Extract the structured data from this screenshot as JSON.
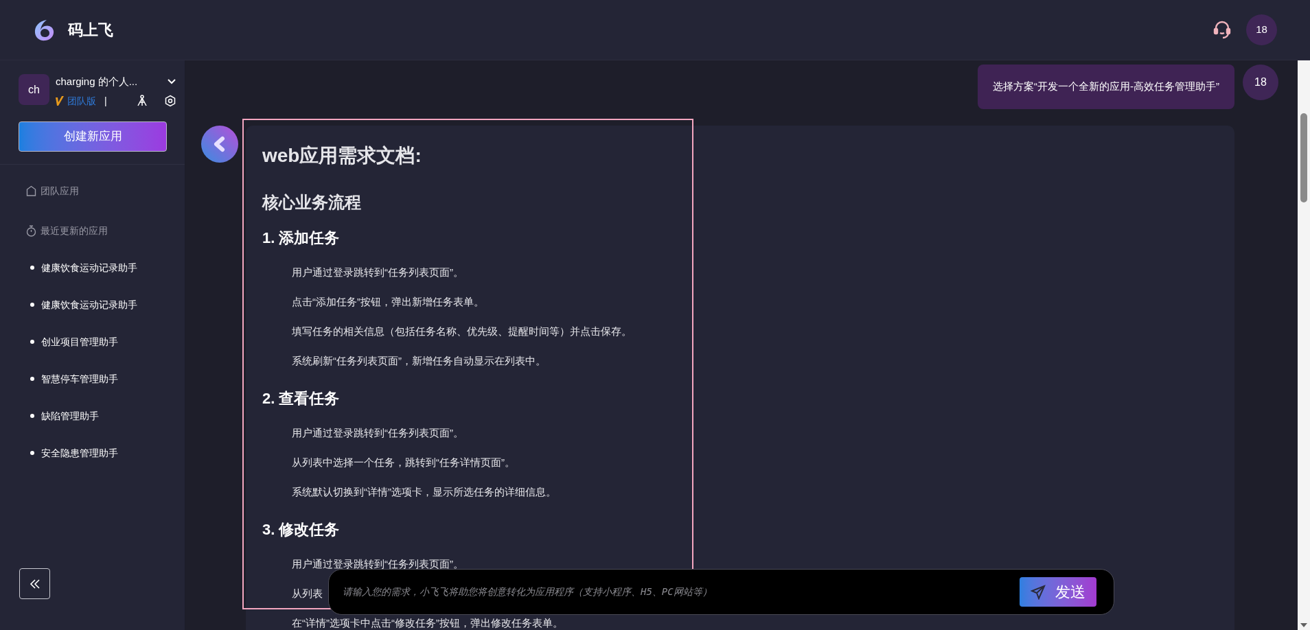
{
  "header": {
    "title": "码上飞",
    "avatar": "18"
  },
  "sidebar": {
    "workspace": {
      "avatar": "ch",
      "name": "charging 的个人...",
      "edition": "团队版",
      "separator": "|"
    },
    "create_button": "创建新应用",
    "nav": [
      {
        "kind": "home",
        "label": "团队应用"
      },
      {
        "kind": "timer",
        "label": "最近更新的应用"
      }
    ],
    "recent_apps": [
      "健康饮食运动记录助手",
      "健康饮食运动记录助手",
      "创业项目管理助手",
      "智慧停车管理助手",
      "缺陷管理助手",
      "安全隐患管理助手"
    ]
  },
  "chat": {
    "user_message": {
      "text": "选择方案“开发一个全新的应用-高效任务管理助手”",
      "avatar": "18"
    },
    "bot_message": [
      {
        "kind": "h1",
        "text": "web应用需求文档:"
      },
      {
        "kind": "h2",
        "text": "核心业务流程"
      },
      {
        "kind": "h3",
        "text": "1. 添加任务"
      },
      {
        "kind": "p",
        "text": "用户通过登录跳转到“任务列表页面”。"
      },
      {
        "kind": "p",
        "text": "点击“添加任务”按钮，弹出新增任务表单。"
      },
      {
        "kind": "p",
        "text": "填写任务的相关信息（包括任务名称、优先级、提醒时间等）并点击保存。"
      },
      {
        "kind": "p",
        "text": "系统刷新“任务列表页面”，新增任务自动显示在列表中。"
      },
      {
        "kind": "h3",
        "text": "2. 查看任务"
      },
      {
        "kind": "p",
        "text": "用户通过登录跳转到“任务列表页面”。"
      },
      {
        "kind": "p",
        "text": "从列表中选择一个任务，跳转到“任务详情页面”。"
      },
      {
        "kind": "p",
        "text": "系统默认切换到“详情”选项卡，显示所选任务的详细信息。"
      },
      {
        "kind": "h3",
        "text": "3. 修改任务"
      },
      {
        "kind": "p",
        "text": "用户通过登录跳转到“任务列表页面”。"
      },
      {
        "kind": "p",
        "text": "从列表"
      },
      {
        "kind": "p",
        "text": "在“详情”选项卡中点击“修改任务”按钮，弹出修改任务表单。"
      }
    ]
  },
  "composer": {
    "placeholder": "请输入您的需求，小飞飞将助您将创意转化为应用程序（支持小程序、H5、PC网站等）",
    "send_button": "发送"
  }
}
